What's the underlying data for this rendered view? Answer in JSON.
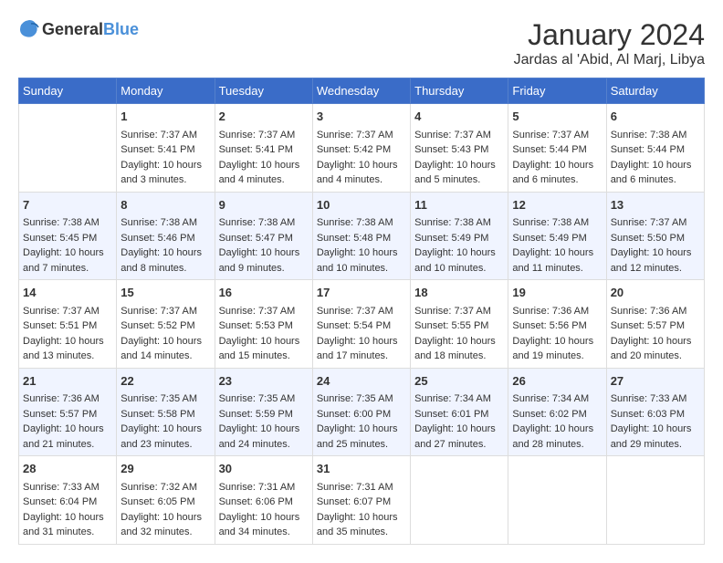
{
  "logo": {
    "text_general": "General",
    "text_blue": "Blue"
  },
  "header": {
    "month_year": "January 2024",
    "location": "Jardas al 'Abid, Al Marj, Libya"
  },
  "days_of_week": [
    "Sunday",
    "Monday",
    "Tuesday",
    "Wednesday",
    "Thursday",
    "Friday",
    "Saturday"
  ],
  "weeks": [
    [
      {
        "num": "",
        "info": ""
      },
      {
        "num": "1",
        "info": "Sunrise: 7:37 AM\nSunset: 5:41 PM\nDaylight: 10 hours\nand 3 minutes."
      },
      {
        "num": "2",
        "info": "Sunrise: 7:37 AM\nSunset: 5:41 PM\nDaylight: 10 hours\nand 4 minutes."
      },
      {
        "num": "3",
        "info": "Sunrise: 7:37 AM\nSunset: 5:42 PM\nDaylight: 10 hours\nand 4 minutes."
      },
      {
        "num": "4",
        "info": "Sunrise: 7:37 AM\nSunset: 5:43 PM\nDaylight: 10 hours\nand 5 minutes."
      },
      {
        "num": "5",
        "info": "Sunrise: 7:37 AM\nSunset: 5:44 PM\nDaylight: 10 hours\nand 6 minutes."
      },
      {
        "num": "6",
        "info": "Sunrise: 7:38 AM\nSunset: 5:44 PM\nDaylight: 10 hours\nand 6 minutes."
      }
    ],
    [
      {
        "num": "7",
        "info": "Sunrise: 7:38 AM\nSunset: 5:45 PM\nDaylight: 10 hours\nand 7 minutes."
      },
      {
        "num": "8",
        "info": "Sunrise: 7:38 AM\nSunset: 5:46 PM\nDaylight: 10 hours\nand 8 minutes."
      },
      {
        "num": "9",
        "info": "Sunrise: 7:38 AM\nSunset: 5:47 PM\nDaylight: 10 hours\nand 9 minutes."
      },
      {
        "num": "10",
        "info": "Sunrise: 7:38 AM\nSunset: 5:48 PM\nDaylight: 10 hours\nand 10 minutes."
      },
      {
        "num": "11",
        "info": "Sunrise: 7:38 AM\nSunset: 5:49 PM\nDaylight: 10 hours\nand 10 minutes."
      },
      {
        "num": "12",
        "info": "Sunrise: 7:38 AM\nSunset: 5:49 PM\nDaylight: 10 hours\nand 11 minutes."
      },
      {
        "num": "13",
        "info": "Sunrise: 7:37 AM\nSunset: 5:50 PM\nDaylight: 10 hours\nand 12 minutes."
      }
    ],
    [
      {
        "num": "14",
        "info": "Sunrise: 7:37 AM\nSunset: 5:51 PM\nDaylight: 10 hours\nand 13 minutes."
      },
      {
        "num": "15",
        "info": "Sunrise: 7:37 AM\nSunset: 5:52 PM\nDaylight: 10 hours\nand 14 minutes."
      },
      {
        "num": "16",
        "info": "Sunrise: 7:37 AM\nSunset: 5:53 PM\nDaylight: 10 hours\nand 15 minutes."
      },
      {
        "num": "17",
        "info": "Sunrise: 7:37 AM\nSunset: 5:54 PM\nDaylight: 10 hours\nand 17 minutes."
      },
      {
        "num": "18",
        "info": "Sunrise: 7:37 AM\nSunset: 5:55 PM\nDaylight: 10 hours\nand 18 minutes."
      },
      {
        "num": "19",
        "info": "Sunrise: 7:36 AM\nSunset: 5:56 PM\nDaylight: 10 hours\nand 19 minutes."
      },
      {
        "num": "20",
        "info": "Sunrise: 7:36 AM\nSunset: 5:57 PM\nDaylight: 10 hours\nand 20 minutes."
      }
    ],
    [
      {
        "num": "21",
        "info": "Sunrise: 7:36 AM\nSunset: 5:57 PM\nDaylight: 10 hours\nand 21 minutes."
      },
      {
        "num": "22",
        "info": "Sunrise: 7:35 AM\nSunset: 5:58 PM\nDaylight: 10 hours\nand 23 minutes."
      },
      {
        "num": "23",
        "info": "Sunrise: 7:35 AM\nSunset: 5:59 PM\nDaylight: 10 hours\nand 24 minutes."
      },
      {
        "num": "24",
        "info": "Sunrise: 7:35 AM\nSunset: 6:00 PM\nDaylight: 10 hours\nand 25 minutes."
      },
      {
        "num": "25",
        "info": "Sunrise: 7:34 AM\nSunset: 6:01 PM\nDaylight: 10 hours\nand 27 minutes."
      },
      {
        "num": "26",
        "info": "Sunrise: 7:34 AM\nSunset: 6:02 PM\nDaylight: 10 hours\nand 28 minutes."
      },
      {
        "num": "27",
        "info": "Sunrise: 7:33 AM\nSunset: 6:03 PM\nDaylight: 10 hours\nand 29 minutes."
      }
    ],
    [
      {
        "num": "28",
        "info": "Sunrise: 7:33 AM\nSunset: 6:04 PM\nDaylight: 10 hours\nand 31 minutes."
      },
      {
        "num": "29",
        "info": "Sunrise: 7:32 AM\nSunset: 6:05 PM\nDaylight: 10 hours\nand 32 minutes."
      },
      {
        "num": "30",
        "info": "Sunrise: 7:31 AM\nSunset: 6:06 PM\nDaylight: 10 hours\nand 34 minutes."
      },
      {
        "num": "31",
        "info": "Sunrise: 7:31 AM\nSunset: 6:07 PM\nDaylight: 10 hours\nand 35 minutes."
      },
      {
        "num": "",
        "info": ""
      },
      {
        "num": "",
        "info": ""
      },
      {
        "num": "",
        "info": ""
      }
    ]
  ]
}
